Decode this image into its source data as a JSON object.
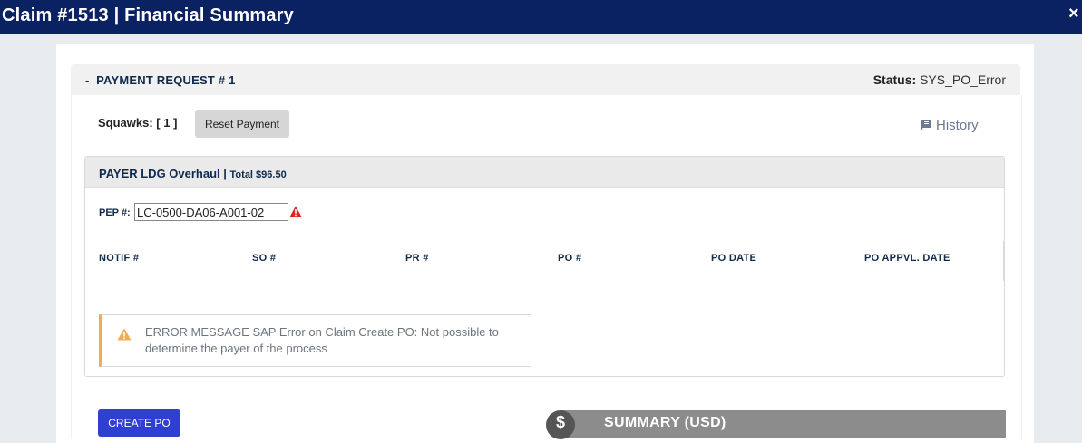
{
  "window": {
    "title": "Claim #1513 | Financial Summary",
    "close_glyph": "×"
  },
  "payment_request": {
    "toggle": "-",
    "title": "PAYMENT REQUEST # 1",
    "status_label": "Status:",
    "status_value": "SYS_PO_Error",
    "squawks_label": "Squawks: [ 1 ]",
    "reset_button": "Reset Payment",
    "history_link": "History",
    "history_icon": "book-icon"
  },
  "payer": {
    "title": "PAYER LDG Overhaul |",
    "total": "Total $96.50",
    "pep_label": "PEP #:",
    "pep_value": "LC-0500-DA06-A001-02",
    "pep_warning_icon": "warning-triangle-icon",
    "warning_color": "#e02424",
    "columns": [
      "NOTIF #",
      "SO #",
      "PR #",
      "PO #",
      "PO DATE",
      "PO APPVL. DATE"
    ]
  },
  "error": {
    "message": "ERROR MESSAGE SAP Error on Claim Create PO: Not possible to determine the payer of the process",
    "icon": "warning-icon",
    "accent_color": "#f0ad4e"
  },
  "actions": {
    "create_po": "CREATE PO"
  },
  "summary": {
    "coin_glyph": "$",
    "label": "SUMMARY (USD)"
  },
  "colors": {
    "titlebar": "#0a2162",
    "create_po_button": "#2f3fd1",
    "summary_bar": "#8c8c8c"
  }
}
